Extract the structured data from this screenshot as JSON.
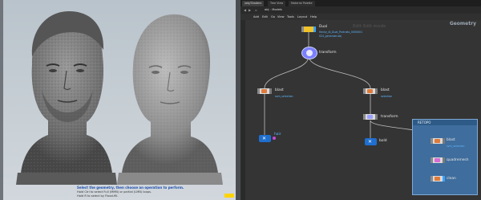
{
  "viewport": {
    "status_line1": "Select the geometry, then choose an operation to perform.",
    "status_line2": "Hold Ctrl to select Full (MMB) or partial (LMB) loops.",
    "status_line3": "Hold R to select by Flood-fill."
  },
  "network": {
    "tabs": [
      "/obj/Shaders",
      "Tree View",
      "Material Palette"
    ],
    "path": [
      "obj",
      "Models"
    ],
    "menu": [
      "Add",
      "Edit",
      "Go",
      "View",
      "Tools",
      "Layout",
      "Help"
    ],
    "context_label": "Geometry",
    "ghost_label": "Edit Edit mode",
    "nodes": {
      "dual": {
        "label": "Dual",
        "sub1": "Hecky_AI_Dual_Portraits_0000001",
        "sub2": "024_generate.obj"
      },
      "transform_top": {
        "label": "transform"
      },
      "blast_left": {
        "label": "blast",
        "sub": "svm_selection"
      },
      "blast_right": {
        "label": "blast",
        "sub": "selection"
      },
      "transform_right": {
        "label": "transform"
      },
      "hair": {
        "label": "hair"
      },
      "bold": {
        "label": "bold"
      },
      "retopo_blast": {
        "label": "blast",
        "sub": "svm_selection"
      },
      "quadremesh": {
        "label": "quadremesh"
      },
      "clean": {
        "label": "clean"
      }
    },
    "group_title": "RETOPO"
  },
  "colors": {
    "wire": "#bfbfbf",
    "group_fill": "#3f6d9d",
    "display_flag": "#3aa3ff",
    "node_yellow": "#f0c22b"
  }
}
